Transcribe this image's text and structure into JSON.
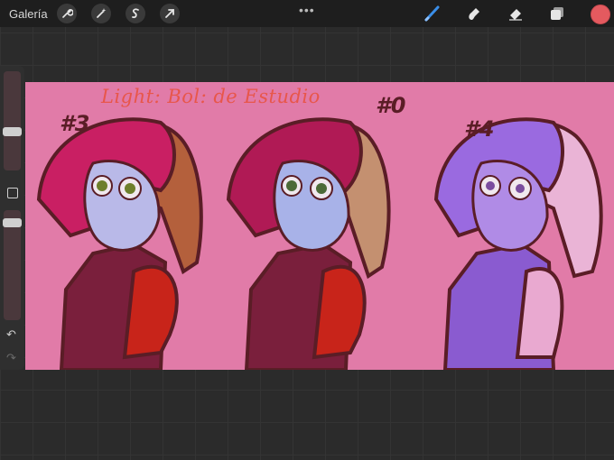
{
  "topbar": {
    "gallery_label": "Galería",
    "left_tools": [
      "wrench-icon",
      "magic-wand-icon",
      "selection-s-icon",
      "transform-arrow-icon"
    ],
    "right_tools": [
      "brush-icon",
      "smudge-icon",
      "eraser-icon",
      "layers-icon"
    ],
    "current_color": "#e45a5f"
  },
  "sidebar": {
    "brush_size_level": 0.2,
    "opacity_level": 0.55
  },
  "canvas": {
    "background_color": "#e17ba8",
    "handwritten_title": "Light: Bol: de Estudio",
    "figures": [
      {
        "label": "#3"
      },
      {
        "label": "#0"
      },
      {
        "label": "#4"
      }
    ]
  }
}
